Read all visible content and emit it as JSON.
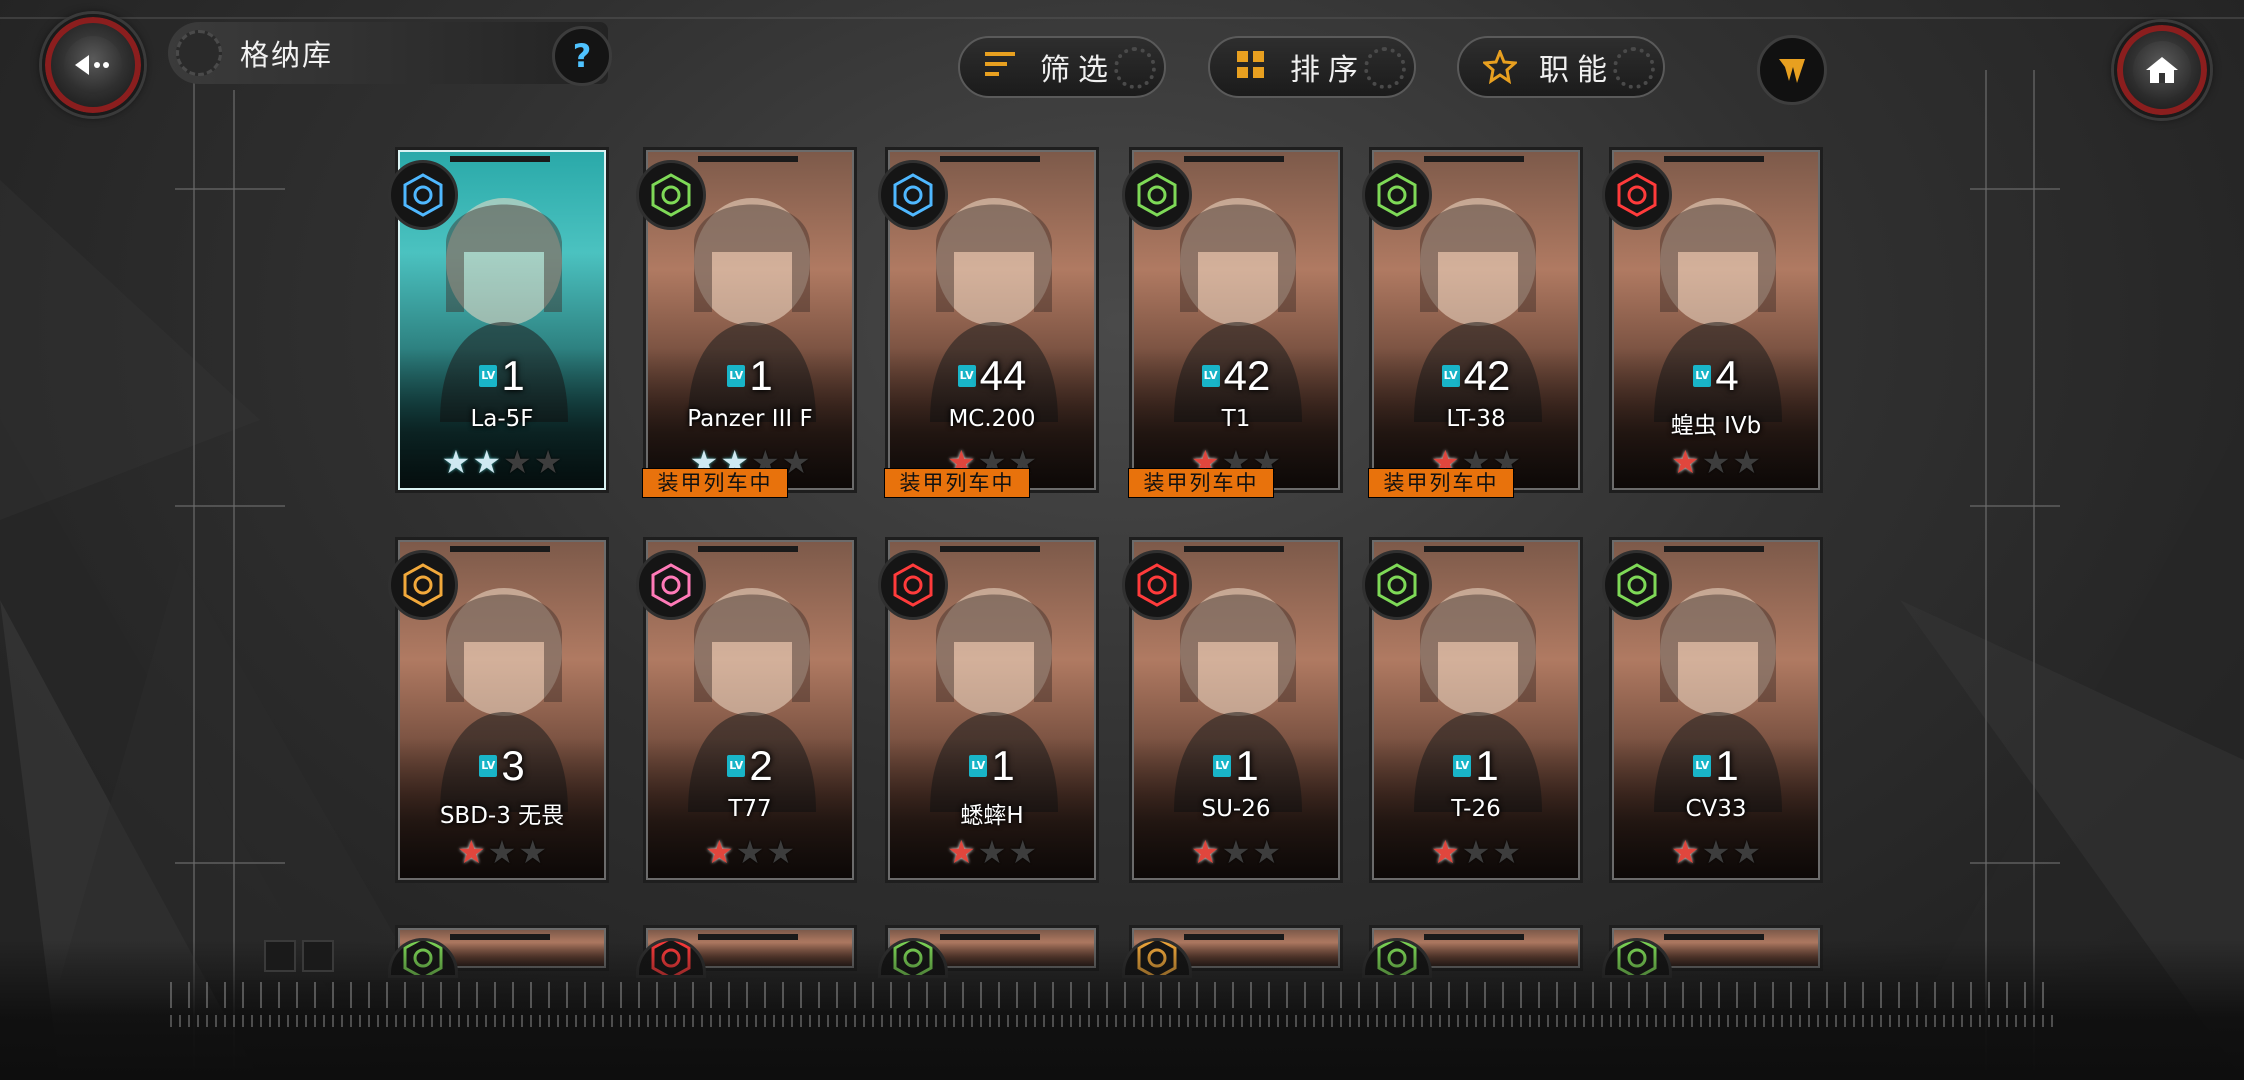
{
  "header": {
    "title": "格纳库",
    "back_icon": "back-arrow-icon",
    "help_label": "?",
    "home_icon": "home-icon",
    "util_icon": "platoon-icon"
  },
  "toolbar": {
    "filter_label": "筛选",
    "sort_label": "排序",
    "role_label": "职能"
  },
  "accent_colors": {
    "orange": "#e8720c",
    "cyan": "#19b5c8",
    "rarity_red": "#e0463d"
  },
  "cards": [
    {
      "name": "La-5F",
      "level": "1",
      "class_icon": "heavy-fighter-icon",
      "class_color": "#4fb8ff",
      "rarity": "silver",
      "stars_filled": 2,
      "stars_total": 4,
      "tag": ""
    },
    {
      "name": "Panzer III F",
      "level": "1",
      "class_icon": "medium-tank-icon",
      "class_color": "#7ed957",
      "rarity": "silver",
      "stars_filled": 2,
      "stars_total": 4,
      "tag": "装甲列车中"
    },
    {
      "name": "MC.200",
      "level": "44",
      "class_icon": "heavy-fighter-icon",
      "class_color": "#4fb8ff",
      "rarity": "red",
      "stars_filled": 1,
      "stars_total": 3,
      "tag": "装甲列车中"
    },
    {
      "name": "T1",
      "level": "42",
      "class_icon": "light-tank-icon",
      "class_color": "#7ed957",
      "rarity": "red",
      "stars_filled": 1,
      "stars_total": 3,
      "tag": "装甲列车中"
    },
    {
      "name": "LT-38",
      "level": "42",
      "class_icon": "medium-tank-icon",
      "class_color": "#7ed957",
      "rarity": "red",
      "stars_filled": 1,
      "stars_total": 3,
      "tag": "装甲列车中"
    },
    {
      "name": "蝗虫 IVb",
      "level": "4",
      "class_icon": "artillery-icon",
      "class_color": "#ff3b3b",
      "rarity": "red",
      "stars_filled": 1,
      "stars_total": 3,
      "tag": ""
    },
    {
      "name": "SBD-3 无畏",
      "level": "3",
      "class_icon": "bomber-icon",
      "class_color": "#f2a93b",
      "rarity": "red",
      "stars_filled": 1,
      "stars_total": 3,
      "tag": ""
    },
    {
      "name": "T77",
      "level": "2",
      "class_icon": "anti-air-icon",
      "class_color": "#ff7ab8",
      "rarity": "red",
      "stars_filled": 1,
      "stars_total": 3,
      "tag": ""
    },
    {
      "name": "蟋蟀H",
      "level": "1",
      "class_icon": "artillery-icon",
      "class_color": "#ff3b3b",
      "rarity": "red",
      "stars_filled": 1,
      "stars_total": 3,
      "tag": ""
    },
    {
      "name": "SU-26",
      "level": "1",
      "class_icon": "artillery-icon",
      "class_color": "#ff3b3b",
      "rarity": "red",
      "stars_filled": 1,
      "stars_total": 3,
      "tag": ""
    },
    {
      "name": "T-26",
      "level": "1",
      "class_icon": "medium-tank-icon",
      "class_color": "#7ed957",
      "rarity": "red",
      "stars_filled": 1,
      "stars_total": 3,
      "tag": ""
    },
    {
      "name": "CV33",
      "level": "1",
      "class_icon": "medium-tank-icon",
      "class_color": "#7ed957",
      "rarity": "red",
      "stars_filled": 1,
      "stars_total": 3,
      "tag": ""
    }
  ],
  "peek_cards": [
    {
      "class_icon": "medium-tank-icon",
      "class_color": "#7ed957"
    },
    {
      "class_icon": "artillery-icon",
      "class_color": "#ff3b3b"
    },
    {
      "class_icon": "medium-tank-icon",
      "class_color": "#7ed957"
    },
    {
      "class_icon": "bomber-icon",
      "class_color": "#f2a93b"
    },
    {
      "class_icon": "medium-tank-icon",
      "class_color": "#7ed957"
    },
    {
      "class_icon": "medium-tank-icon",
      "class_color": "#7ed957"
    }
  ],
  "level_badge_text": "LV"
}
